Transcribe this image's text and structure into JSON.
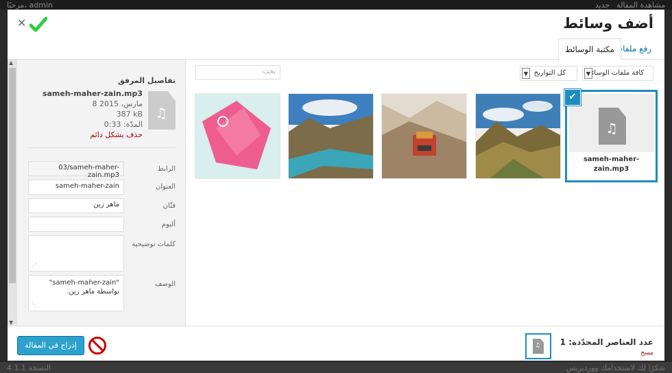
{
  "adminbar": {
    "site_items": [
      "مرحبًا، admin",
      "مشاهدة المقالة",
      "جديد"
    ]
  },
  "modal": {
    "title": "أضف وسائط",
    "tabs": {
      "upload": "رفع ملفات",
      "library": "مكتبة الوسائط"
    }
  },
  "toolbar": {
    "filter_type": "كافة ملفات الوسائط",
    "filter_date": "كل التواريخ",
    "search_placeholder": "بحث"
  },
  "grid": {
    "items": [
      {
        "kind": "audio",
        "caption": "sameh-maher-zain.mp3",
        "selected": true
      },
      {
        "kind": "image",
        "caption": "",
        "selected": false
      },
      {
        "kind": "image",
        "caption": "",
        "selected": false
      },
      {
        "kind": "image",
        "caption": "",
        "selected": false
      },
      {
        "kind": "image",
        "caption": "",
        "selected": false
      }
    ]
  },
  "sidebar": {
    "title": "تفاصيل المرفق",
    "filename": "sameh-maher-zain.mp3",
    "date": "8 مارس، 2015",
    "size": "387 kB",
    "length": "المدّة: 0:33",
    "delete": "حذف بشكل دائم",
    "fields": {
      "url_label": "الرابط",
      "url_value": "03/sameh-maher-zain.mp3",
      "title_label": "العنوان",
      "title_value": "sameh-maher-zain",
      "artist_label": "فنّان",
      "artist_value": "ماهر زين",
      "album_label": "ألبوم",
      "album_value": "",
      "caption_label": "كلمات توضيحية",
      "caption_value": "",
      "description_label": "الوصف",
      "description_value": "\"sameh-maher-zain\" بواسطة ماهر زين."
    }
  },
  "footer": {
    "insert_button": "إدراج في المقالة",
    "selected_count": "عدد العناصر المحدّدة: 1",
    "clear": "مسح"
  },
  "page_footer": {
    "left": "النسخة 4.1.1",
    "right": "شكرًا لك لاستخدامك ووردبريس"
  },
  "colors": {
    "accent": "#1e8cbe",
    "button": "#2ea2cc",
    "danger": "#aa0000",
    "check": "#2ecc40"
  },
  "icons": {
    "close": "close-icon",
    "confirm": "checkmark-icon",
    "audio": "audio-file-icon",
    "forbidden": "no-entry-icon"
  }
}
